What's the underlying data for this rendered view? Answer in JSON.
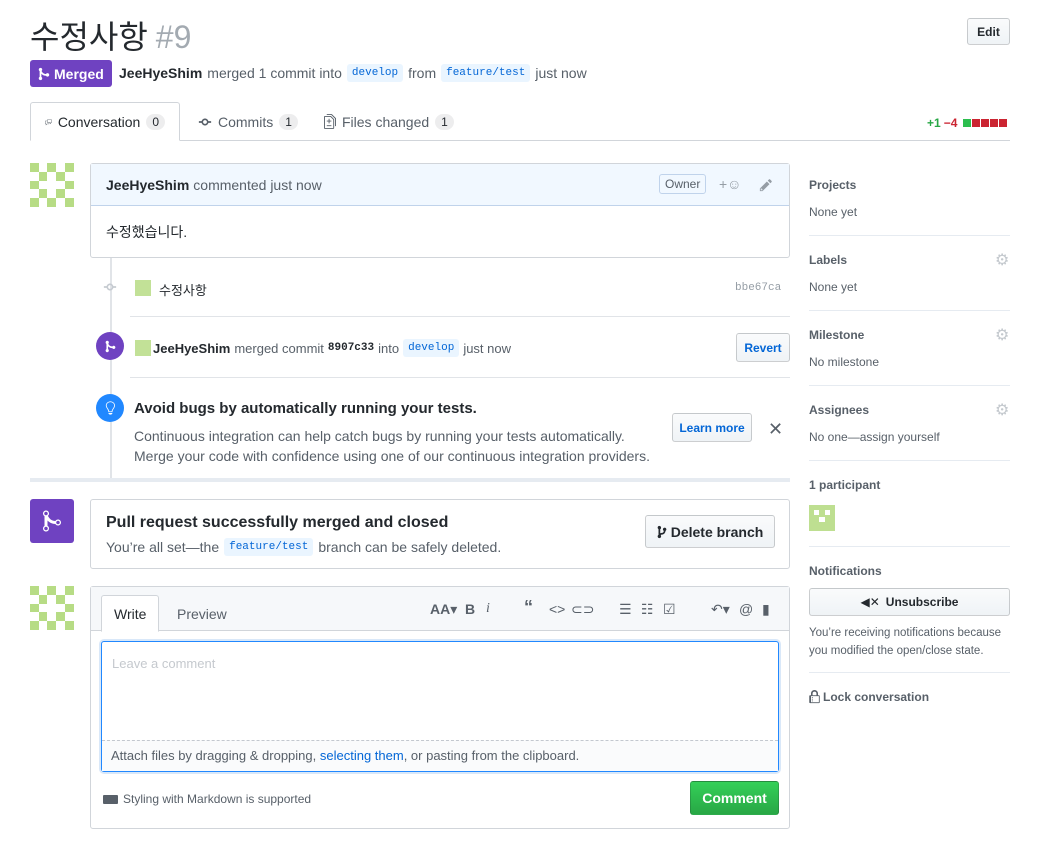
{
  "header": {
    "title": "수정사항",
    "number": "#9",
    "edit_label": "Edit",
    "state": "Merged",
    "author": "JeeHyeShim",
    "merged_text": "merged 1 commit into",
    "base_branch": "develop",
    "from_text": "from",
    "head_branch": "feature/test",
    "time": "just now"
  },
  "tabs": [
    {
      "label": "Conversation",
      "count": "0"
    },
    {
      "label": "Commits",
      "count": "1"
    },
    {
      "label": "Files changed",
      "count": "1"
    }
  ],
  "diffstat": {
    "additions": "+1",
    "deletions": "−4",
    "colors": {
      "add": "#2cbe4e",
      "del": "#cb2431",
      "neutral": "#d1d5da"
    }
  },
  "comment": {
    "author": "JeeHyeShim",
    "action": "commented just now",
    "owner_label": "Owner",
    "reaction_icon": "+☺",
    "body": "수정했습니다."
  },
  "commit": {
    "message": "수정사항",
    "sha": "bbe67ca"
  },
  "merge_event": {
    "author": "JeeHyeShim",
    "text1": "merged commit",
    "sha": "8907c33",
    "text2": "into",
    "branch": "develop",
    "time": "just now",
    "revert_label": "Revert"
  },
  "ci_tip": {
    "title": "Avoid bugs by automatically running your tests.",
    "line1": "Continuous integration can help catch bugs by running your tests automatically.",
    "line2": "Merge your code with confidence using one of our continuous integration providers.",
    "learn_more": "Learn more"
  },
  "merged_box": {
    "title": "Pull request successfully merged and closed",
    "text_before": "You’re all set—the",
    "branch": "feature/test",
    "text_after": "branch can be safely deleted.",
    "delete_label": "Delete branch"
  },
  "editor": {
    "write_tab": "Write",
    "preview_tab": "Preview",
    "placeholder": "Leave a comment",
    "attach_before": "Attach files by dragging & dropping,",
    "attach_link": "selecting them",
    "attach_after": ", or pasting from the clipboard.",
    "markdown_note": "Styling with Markdown is supported",
    "comment_label": "Comment"
  },
  "sidebar": {
    "projects": {
      "title": "Projects",
      "value": "None yet"
    },
    "labels": {
      "title": "Labels",
      "value": "None yet"
    },
    "milestone": {
      "title": "Milestone",
      "value": "No milestone"
    },
    "assignees": {
      "title": "Assignees",
      "value": "No one—assign yourself"
    },
    "participants": {
      "title": "1 participant"
    },
    "notifications": {
      "title": "Notifications",
      "unsubscribe_label": "Unsubscribe",
      "reason_line1": "You’re receiving notifications because",
      "reason_line2": "you modified the open/close state."
    },
    "lock_label": "Lock conversation"
  },
  "colors": {
    "merged_purple": "#6f42c1",
    "link_blue": "#0366d6",
    "green": "#28a745",
    "avatar_green": "#b7dc85"
  }
}
